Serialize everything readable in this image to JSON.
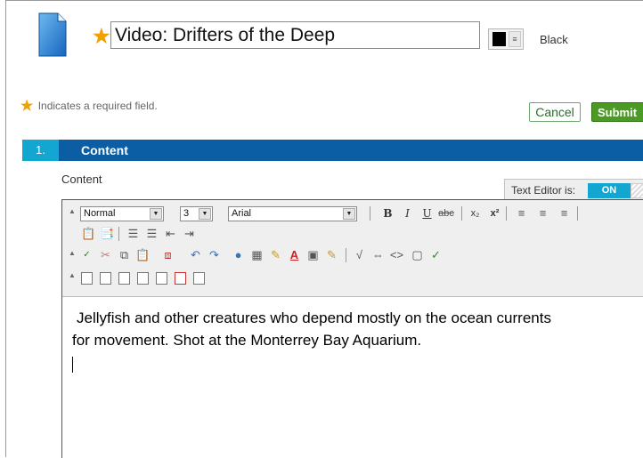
{
  "header": {
    "title_value": "Video: Drifters of the Deep",
    "required_star": "★",
    "color_label": "Black",
    "color_value": "#000000"
  },
  "required_note": {
    "star": "★",
    "text": "Indicates a required field."
  },
  "actions": {
    "cancel_label": "Cancel",
    "submit_label": "Submit"
  },
  "section": {
    "number": "1.",
    "title": "Content"
  },
  "content_field": {
    "label": "Content",
    "editor_status_label": "Text Editor is:",
    "editor_status_value": "ON"
  },
  "toolbar": {
    "format_value": "Normal",
    "size_value": "3",
    "font_value": "Arial",
    "bold": "B",
    "italic": "I",
    "underline": "U",
    "strikethrough": "abc",
    "subscript": "x₂",
    "superscript": "x²"
  },
  "editor": {
    "line1": "Jellyfish and other creatures who depend mostly on the ocean currents",
    "line2": "for movement. Shot at the Monterrey Bay Aquarium."
  },
  "icons": {
    "document": "document-icon",
    "required": "star-icon",
    "color_dropdown": "chevron-down-icon"
  },
  "colors": {
    "section_bar": "#0c5ea4",
    "section_number_bg": "#13a6d0",
    "submit_bg": "#4a9a23",
    "required_star": "#f0a000",
    "toggle_on": "#13a6d0"
  }
}
